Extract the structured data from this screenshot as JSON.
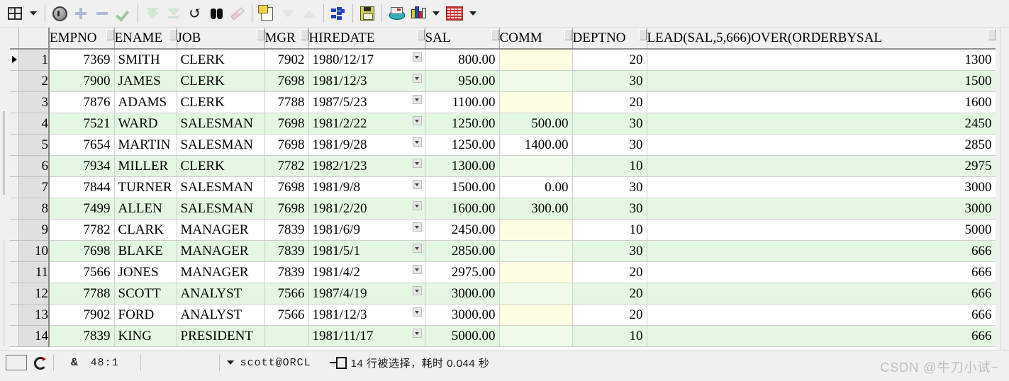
{
  "toolbar": {
    "items": [
      {
        "name": "grid-layout-icon",
        "label": "Grid Layout"
      },
      {
        "name": "grid-layout-dropdown-icon",
        "label": "Grid Layout Options"
      },
      {
        "name": "lock-icon",
        "label": "Lock Record"
      },
      {
        "name": "add-row-icon",
        "label": "Insert Row"
      },
      {
        "name": "remove-row-icon",
        "label": "Delete Row"
      },
      {
        "name": "commit-check-icon",
        "label": "Post Changes"
      },
      {
        "name": "fetch-all-icon",
        "label": "Fetch All Records"
      },
      {
        "name": "fetch-page-icon",
        "label": "Fetch Last Page"
      },
      {
        "name": "refresh-icon",
        "label": "Refresh"
      },
      {
        "name": "find-icon",
        "label": "Find"
      },
      {
        "name": "highlight-icon",
        "label": "Highlight"
      },
      {
        "name": "copy-sql-icon",
        "label": "Copy to Clipboard"
      },
      {
        "name": "sort-desc-icon",
        "label": "Sort Descending"
      },
      {
        "name": "sort-asc-icon",
        "label": "Sort Ascending"
      },
      {
        "name": "explain-plan-icon",
        "label": "Explain Plan"
      },
      {
        "name": "save-icon",
        "label": "Export Results"
      },
      {
        "name": "db-export-icon",
        "label": "Export Data"
      },
      {
        "name": "chart-icon",
        "label": "Chart"
      },
      {
        "name": "chart-dropdown-icon",
        "label": "Chart Options"
      },
      {
        "name": "table-view-icon",
        "label": "Table View"
      },
      {
        "name": "table-view-dropdown-icon",
        "label": "View Options"
      }
    ]
  },
  "grid": {
    "columns": [
      {
        "key": "empno",
        "label": "EMPNO",
        "align": "num"
      },
      {
        "key": "ename",
        "label": "ENAME",
        "align": "txt"
      },
      {
        "key": "job",
        "label": "JOB",
        "align": "txt"
      },
      {
        "key": "mgr",
        "label": "MGR",
        "align": "num"
      },
      {
        "key": "hire",
        "label": "HIREDATE",
        "align": "date"
      },
      {
        "key": "sal",
        "label": "SAL",
        "align": "num"
      },
      {
        "key": "comm",
        "label": "COMM",
        "align": "num"
      },
      {
        "key": "deptno",
        "label": "DEPTNO",
        "align": "num"
      },
      {
        "key": "lead",
        "label": "LEAD(SAL,5,666)OVER(ORDERBYSAL",
        "align": "num"
      }
    ],
    "rows": [
      {
        "n": "1",
        "empno": "7369",
        "ename": "SMITH",
        "job": "CLERK",
        "mgr": "7902",
        "hire": "1980/12/17",
        "sal": "800.00",
        "comm": "",
        "deptno": "20",
        "lead": "1300"
      },
      {
        "n": "2",
        "empno": "7900",
        "ename": "JAMES",
        "job": "CLERK",
        "mgr": "7698",
        "hire": "1981/12/3",
        "sal": "950.00",
        "comm": "",
        "deptno": "30",
        "lead": "1500"
      },
      {
        "n": "3",
        "empno": "7876",
        "ename": "ADAMS",
        "job": "CLERK",
        "mgr": "7788",
        "hire": "1987/5/23",
        "sal": "1100.00",
        "comm": "",
        "deptno": "20",
        "lead": "1600"
      },
      {
        "n": "4",
        "empno": "7521",
        "ename": "WARD",
        "job": "SALESMAN",
        "mgr": "7698",
        "hire": "1981/2/22",
        "sal": "1250.00",
        "comm": "500.00",
        "deptno": "30",
        "lead": "2450"
      },
      {
        "n": "5",
        "empno": "7654",
        "ename": "MARTIN",
        "job": "SALESMAN",
        "mgr": "7698",
        "hire": "1981/9/28",
        "sal": "1250.00",
        "comm": "1400.00",
        "deptno": "30",
        "lead": "2850"
      },
      {
        "n": "6",
        "empno": "7934",
        "ename": "MILLER",
        "job": "CLERK",
        "mgr": "7782",
        "hire": "1982/1/23",
        "sal": "1300.00",
        "comm": "",
        "deptno": "10",
        "lead": "2975"
      },
      {
        "n": "7",
        "empno": "7844",
        "ename": "TURNER",
        "job": "SALESMAN",
        "mgr": "7698",
        "hire": "1981/9/8",
        "sal": "1500.00",
        "comm": "0.00",
        "deptno": "30",
        "lead": "3000"
      },
      {
        "n": "8",
        "empno": "7499",
        "ename": "ALLEN",
        "job": "SALESMAN",
        "mgr": "7698",
        "hire": "1981/2/20",
        "sal": "1600.00",
        "comm": "300.00",
        "deptno": "30",
        "lead": "3000"
      },
      {
        "n": "9",
        "empno": "7782",
        "ename": "CLARK",
        "job": "MANAGER",
        "mgr": "7839",
        "hire": "1981/6/9",
        "sal": "2450.00",
        "comm": "",
        "deptno": "10",
        "lead": "5000"
      },
      {
        "n": "10",
        "empno": "7698",
        "ename": "BLAKE",
        "job": "MANAGER",
        "mgr": "7839",
        "hire": "1981/5/1",
        "sal": "2850.00",
        "comm": "",
        "deptno": "30",
        "lead": "666"
      },
      {
        "n": "11",
        "empno": "7566",
        "ename": "JONES",
        "job": "MANAGER",
        "mgr": "7839",
        "hire": "1981/4/2",
        "sal": "2975.00",
        "comm": "",
        "deptno": "20",
        "lead": "666"
      },
      {
        "n": "12",
        "empno": "7788",
        "ename": "SCOTT",
        "job": "ANALYST",
        "mgr": "7566",
        "hire": "1987/4/19",
        "sal": "3000.00",
        "comm": "",
        "deptno": "20",
        "lead": "666"
      },
      {
        "n": "13",
        "empno": "7902",
        "ename": "FORD",
        "job": "ANALYST",
        "mgr": "7566",
        "hire": "1981/12/3",
        "sal": "3000.00",
        "comm": "",
        "deptno": "20",
        "lead": "666"
      },
      {
        "n": "14",
        "empno": "7839",
        "ename": "KING",
        "job": "PRESIDENT",
        "mgr": "",
        "hire": "1981/11/17",
        "sal": "5000.00",
        "comm": "",
        "deptno": "10",
        "lead": "666"
      }
    ],
    "current_row_index": 0
  },
  "status": {
    "cursor_position": "48:1",
    "ampersand": "&",
    "connection": "scott@ORCL",
    "message": "14 行被选择，耗时 0.044 秒"
  },
  "watermark": "CSDN @牛刀小试~",
  "colors": {
    "row_alt": "#e4f7e2",
    "null_cell": "#fcfce0",
    "rownum_bg": "#e0e0e0",
    "chrome": "#f0f0f0",
    "watermark": "#bdbdbd"
  }
}
